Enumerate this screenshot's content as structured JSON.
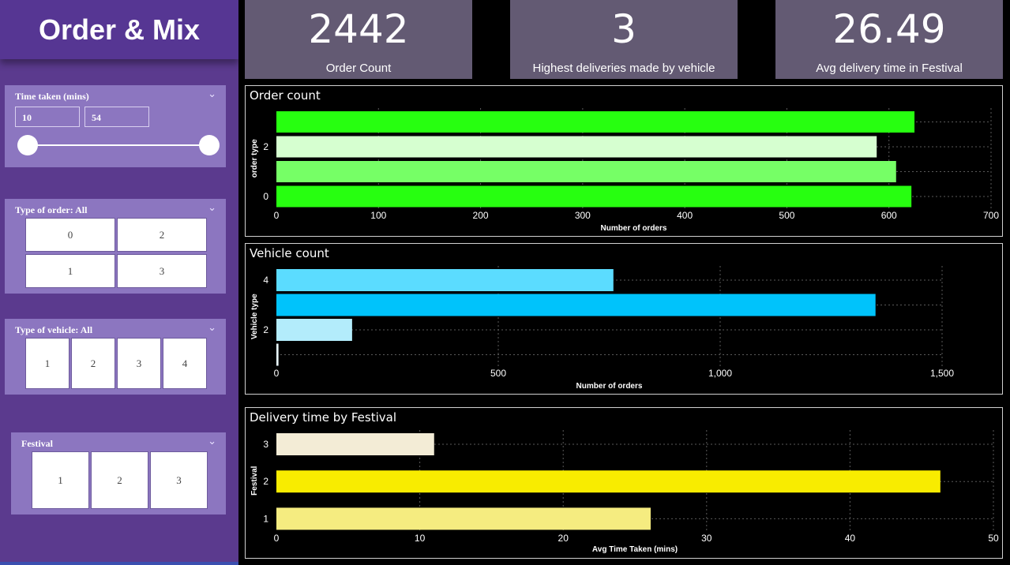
{
  "title": "Order & Mix",
  "kpis": [
    {
      "value": "2442",
      "label": "Order Count"
    },
    {
      "value": "3",
      "label": "Highest deliveries made by vehicle"
    },
    {
      "value": "26.49",
      "label": "Avg delivery time in Festival"
    }
  ],
  "slicers": {
    "time": {
      "title": "Time taken (mins)",
      "min": "10",
      "max": "54"
    },
    "order": {
      "title": "Type of order: All",
      "options": [
        "0",
        "2",
        "1",
        "3"
      ]
    },
    "vehicle": {
      "title": "Type of vehicle: All",
      "options": [
        "1",
        "2",
        "3",
        "4"
      ]
    },
    "festival": {
      "title": "Festival",
      "options": [
        "1",
        "2",
        "3"
      ]
    }
  },
  "colors": {
    "sidebar": "#5b3a8e",
    "slicer_bg": "#8c76c0",
    "kpi_bg": "#635a73"
  },
  "chart_data": [
    {
      "type": "bar",
      "orientation": "horizontal",
      "title": "Order count",
      "xlabel": "Number of orders",
      "ylabel": "order type",
      "categories": [
        "3",
        "2",
        "1",
        "0"
      ],
      "category_labels": [
        "",
        "2",
        "",
        "0"
      ],
      "values": [
        625,
        588,
        607,
        622
      ],
      "colors": [
        "#27ff10",
        "#d6ffd0",
        "#76ff66",
        "#27ff10"
      ],
      "xlim": [
        0,
        700
      ],
      "xticks": [
        "0",
        "100",
        "200",
        "300",
        "400",
        "500",
        "600",
        "700"
      ],
      "grid": true
    },
    {
      "type": "bar",
      "orientation": "horizontal",
      "title": "Vehicle count",
      "xlabel": "Number of orders",
      "ylabel": "Vehicle type",
      "categories": [
        "4",
        "3",
        "2",
        "1"
      ],
      "category_labels": [
        "4",
        "",
        "2",
        ""
      ],
      "values": [
        810,
        1440,
        182,
        5
      ],
      "colors": [
        "#5bdcff",
        "#00c3fb",
        "#b3ecfb",
        "#e8f9ff"
      ],
      "xlim": [
        0,
        1600
      ],
      "xticks": [
        "0",
        "500",
        "1,000",
        "1,500"
      ],
      "grid": true
    },
    {
      "type": "bar",
      "orientation": "horizontal",
      "title": "Delivery time by Festival",
      "xlabel": "Avg Time Taken (mins)",
      "ylabel": "Festival",
      "categories": [
        "3",
        "2",
        "1"
      ],
      "category_labels": [
        "3",
        "2",
        "1"
      ],
      "values": [
        11,
        46.3,
        26.1
      ],
      "colors": [
        "#f3ecd6",
        "#f8ec00",
        "#f5ec80"
      ],
      "xlim": [
        0,
        50
      ],
      "xticks": [
        "0",
        "10",
        "20",
        "30",
        "40",
        "50"
      ],
      "grid": true
    }
  ]
}
